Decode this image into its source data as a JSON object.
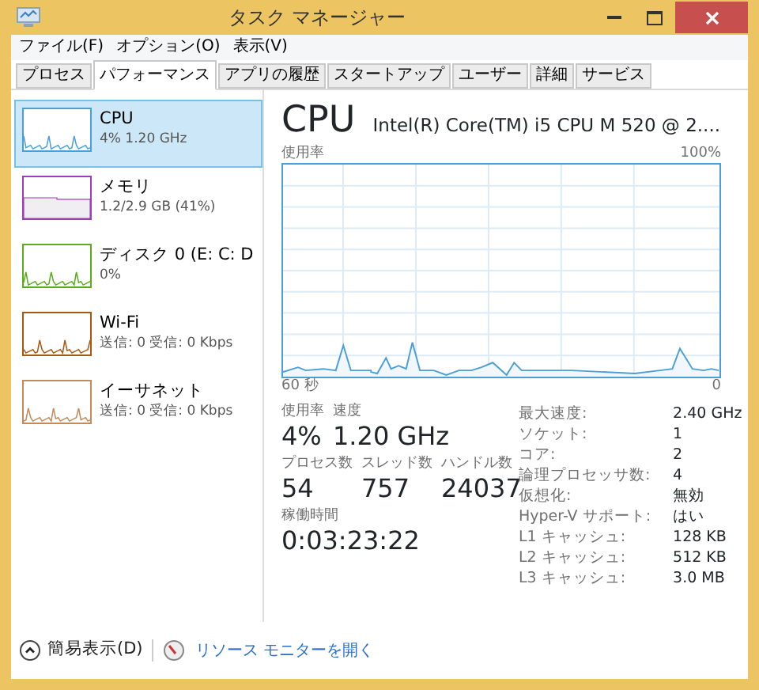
{
  "window": {
    "title": "タスク マネージャー"
  },
  "menu": [
    "ファイル(F)",
    "オプション(O)",
    "表示(V)"
  ],
  "tabs": [
    {
      "label": "プロセス",
      "selected": false
    },
    {
      "label": "パフォーマンス",
      "selected": true
    },
    {
      "label": "アプリの履歴",
      "selected": false
    },
    {
      "label": "スタートアップ",
      "selected": false
    },
    {
      "label": "ユーザー",
      "selected": false
    },
    {
      "label": "詳細",
      "selected": false
    },
    {
      "label": "サービス",
      "selected": false
    }
  ],
  "resources": [
    {
      "name": "CPU",
      "detail": "4% 1.20 GHz",
      "color": "#4a9fd8",
      "kind": "line",
      "selected": true
    },
    {
      "name": "メモリ",
      "detail": "1.2/2.9 GB (41%)",
      "color": "#9c3fb6",
      "kind": "fill",
      "selected": false
    },
    {
      "name": "ディスク 0 (E: C: D",
      "detail": "0%",
      "color": "#5aae1c",
      "kind": "line",
      "selected": false
    },
    {
      "name": "Wi-Fi",
      "detail": "送信: 0 受信: 0 Kbps",
      "color": "#a9580f",
      "kind": "line",
      "selected": false
    },
    {
      "name": "イーサネット",
      "detail": "送信: 0 受信: 0 Kbps",
      "color": "#c38a5a",
      "kind": "line",
      "selected": false
    }
  ],
  "detail": {
    "title": "CPU",
    "model": "Intel(R) Core(TM) i5 CPU M 520 @ 2....",
    "graph_label": "使用率",
    "graph_max": "100%",
    "graph_start": "60 秒",
    "graph_end": "0",
    "stats": [
      [
        {
          "label": "使用率",
          "value": "4%"
        },
        {
          "label": "速度",
          "value": "1.20 GHz"
        }
      ],
      [
        {
          "label": "プロセス数",
          "value": "54"
        },
        {
          "label": "スレッド数",
          "value": "757"
        },
        {
          "label": "ハンドル数",
          "value": "24037"
        }
      ],
      [
        {
          "label": "稼働時間",
          "value": "0:03:23:22"
        }
      ]
    ],
    "specs": [
      {
        "label": "最大速度:",
        "value": "2.40 GHz"
      },
      {
        "label": "ソケット:",
        "value": "1"
      },
      {
        "label": "コア:",
        "value": "2"
      },
      {
        "label": "論理プロセッサ数:",
        "value": "4"
      },
      {
        "label": "仮想化:",
        "value": "無効"
      },
      {
        "label": "Hyper-V サポート:",
        "value": "はい"
      },
      {
        "label": "L1 キャッシュ:",
        "value": "128 KB"
      },
      {
        "label": "L2 キャッシュ:",
        "value": "512 KB"
      },
      {
        "label": "L3 キャッシュ:",
        "value": "3.0 MB"
      }
    ]
  },
  "footer": {
    "fewer_details": "簡易表示(D)",
    "resource_monitor": "リソース モニターを開く"
  }
}
